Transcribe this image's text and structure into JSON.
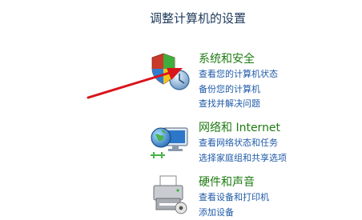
{
  "page_title": "调整计算机的设置",
  "colors": {
    "category_title": "#1e7b12",
    "link": "#1e5aa8",
    "heading": "#1e395b",
    "arrow": "#d9141b"
  },
  "categories": [
    {
      "title": "系统和安全",
      "icon": "shield-clock-icon",
      "links": [
        "查看您的计算机状态",
        "备份您的计算机",
        "查找并解决问题"
      ]
    },
    {
      "title": "网络和 Internet",
      "icon": "network-globe-icon",
      "links": [
        "查看网络状态和任务",
        "选择家庭组和共享选项"
      ]
    },
    {
      "title": "硬件和声音",
      "icon": "printer-icon",
      "links": [
        "查看设备和打印机",
        "添加设备"
      ]
    }
  ]
}
